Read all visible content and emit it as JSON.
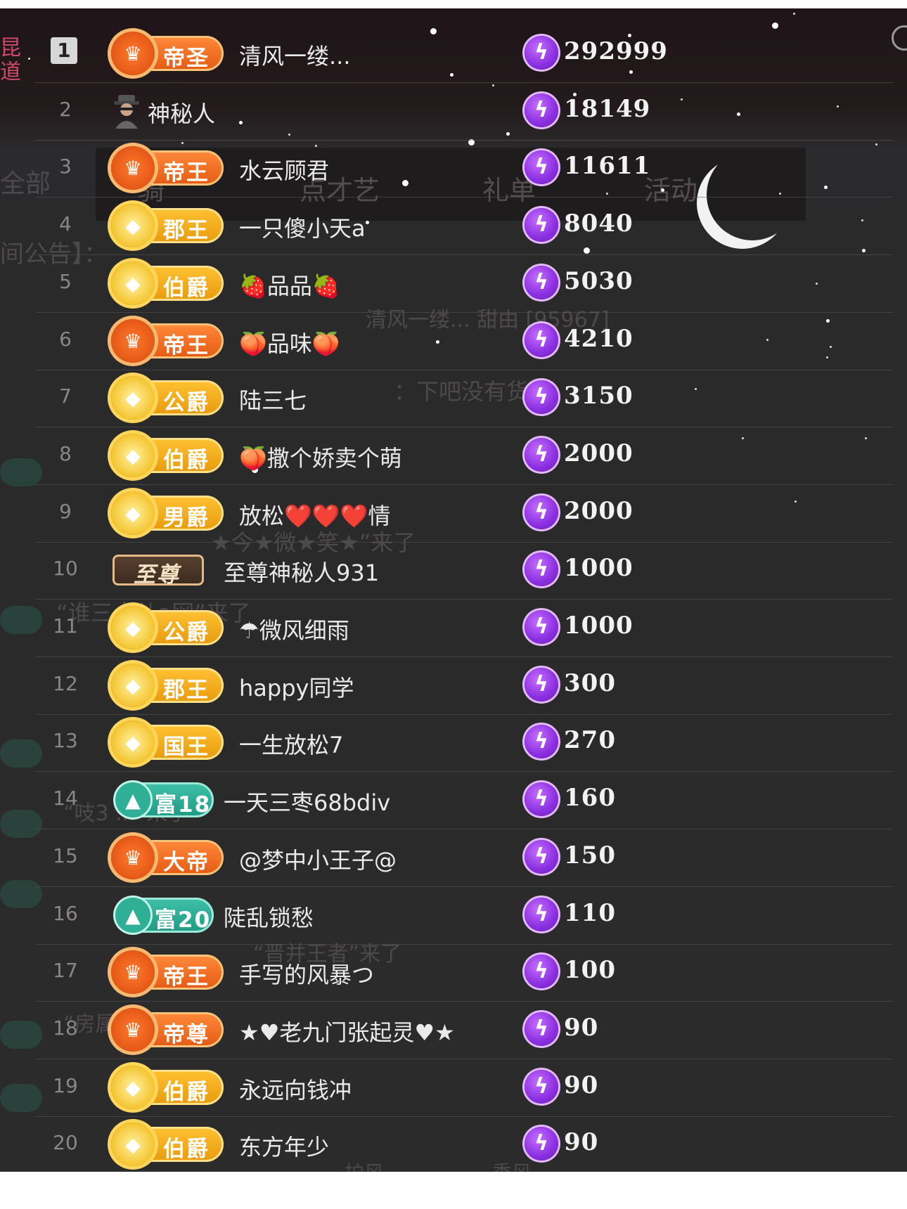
{
  "left_edge_text": [
    "昆",
    "道"
  ],
  "ghost_background": {
    "tabs": [
      "全部",
      "骑",
      "点才艺",
      "礼单",
      "活动"
    ],
    "notice": "间公告】：",
    "chat": [
      "清风一缕... 甜由 [95967]",
      "：下吧没有货了",
      "“谁三点儿a网”来了",
      "★今★微★笑★”来了",
      "“吱3 ...”来了",
      "“晋并王者”来了",
      "“房属 ...”来了",
      "护风",
      "委风"
    ]
  },
  "leaderboard": {
    "rows": [
      {
        "rank": "1",
        "badge": "帝圣",
        "badge_style": "orange",
        "name": "清风一缕...",
        "value": "292999"
      },
      {
        "rank": "2",
        "badge": "",
        "badge_style": "anon",
        "name": "神秘人",
        "value": "18149"
      },
      {
        "rank": "3",
        "badge": "帝王",
        "badge_style": "orange",
        "name": "水云顾君",
        "value": "11611"
      },
      {
        "rank": "4",
        "badge": "郡王",
        "badge_style": "gold",
        "name": "一只傻小天a",
        "value": "8040"
      },
      {
        "rank": "5",
        "badge": "伯爵",
        "badge_style": "gold",
        "name": "🍓品品🍓",
        "value": "5030"
      },
      {
        "rank": "6",
        "badge": "帝王",
        "badge_style": "orange",
        "name": "🍑品味🍑",
        "value": "4210"
      },
      {
        "rank": "7",
        "badge": "公爵",
        "badge_style": "gold",
        "name": "陆三七",
        "value": "3150"
      },
      {
        "rank": "8",
        "badge": "伯爵",
        "badge_style": "gold",
        "name": "🍑撒个娇卖个萌",
        "value": "2000"
      },
      {
        "rank": "9",
        "badge": "男爵",
        "badge_style": "gold",
        "name": "放松❤️❤️❤️情",
        "value": "2000"
      },
      {
        "rank": "10",
        "badge": "至尊",
        "badge_style": "supreme",
        "name": "至尊神秘人931",
        "value": "1000"
      },
      {
        "rank": "11",
        "badge": "公爵",
        "badge_style": "gold",
        "name": "☂微风细雨",
        "value": "1000"
      },
      {
        "rank": "12",
        "badge": "郡王",
        "badge_style": "gold",
        "name": "happy同学",
        "value": "300"
      },
      {
        "rank": "13",
        "badge": "国王",
        "badge_style": "gold",
        "name": "一生放松7",
        "value": "270"
      },
      {
        "rank": "14",
        "badge": "富18",
        "badge_style": "teal",
        "name": "一天三枣68bdiv",
        "value": "160"
      },
      {
        "rank": "15",
        "badge": "大帝",
        "badge_style": "orange",
        "name": "@梦中小王子@",
        "value": "150"
      },
      {
        "rank": "16",
        "badge": "富20",
        "badge_style": "teal",
        "name": "陡乱锁愁",
        "value": "110"
      },
      {
        "rank": "17",
        "badge": "帝王",
        "badge_style": "orange",
        "name": "手写的风暴つ",
        "value": "100"
      },
      {
        "rank": "18",
        "badge": "帝尊",
        "badge_style": "orange",
        "name": "★♥老九门张起灵♥★",
        "value": "90"
      },
      {
        "rank": "19",
        "badge": "伯爵",
        "badge_style": "gold",
        "name": "永远向钱冲",
        "value": "90"
      },
      {
        "rank": "20",
        "badge": "伯爵",
        "badge_style": "gold",
        "name": "东方年少",
        "value": "90"
      }
    ]
  },
  "icons": {
    "coin": "lightning-coin-icon",
    "moon": "crescent-moon-icon",
    "anon": "anonymous-user-icon"
  },
  "colors": {
    "panel_bg": "#2b2b2b",
    "orange_badge": "#e45a12",
    "gold_badge": "#e79a0c",
    "teal_badge": "#1f9a84",
    "coin": "#8a2fe0"
  }
}
